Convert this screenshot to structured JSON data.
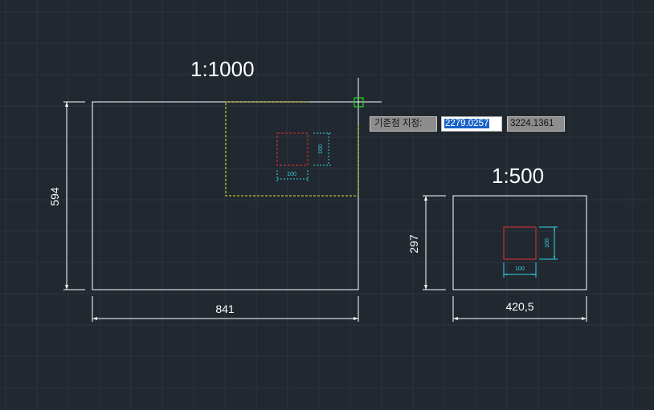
{
  "drawing": {
    "left_sheet": {
      "scale_label": "1:1000",
      "width_dim": "841",
      "height_dim": "594",
      "box_width_dim": "100",
      "box_height_dim": "100"
    },
    "right_sheet": {
      "scale_label": "1:500",
      "width_dim": "420,5",
      "height_dim": "297",
      "box_width_dim": "100",
      "box_height_dim": "100"
    }
  },
  "command_prompt": {
    "label": "기준점 지정:",
    "x_value": "2279.0257",
    "y_value": "3224.1361"
  },
  "colors": {
    "background": "#212830",
    "grid": "#2c343e",
    "lines": "#ffffff",
    "preview": "#e5e52e",
    "box": "#e23232",
    "dimension_small": "#33d6e6",
    "snap_marker": "#1dd11d"
  }
}
